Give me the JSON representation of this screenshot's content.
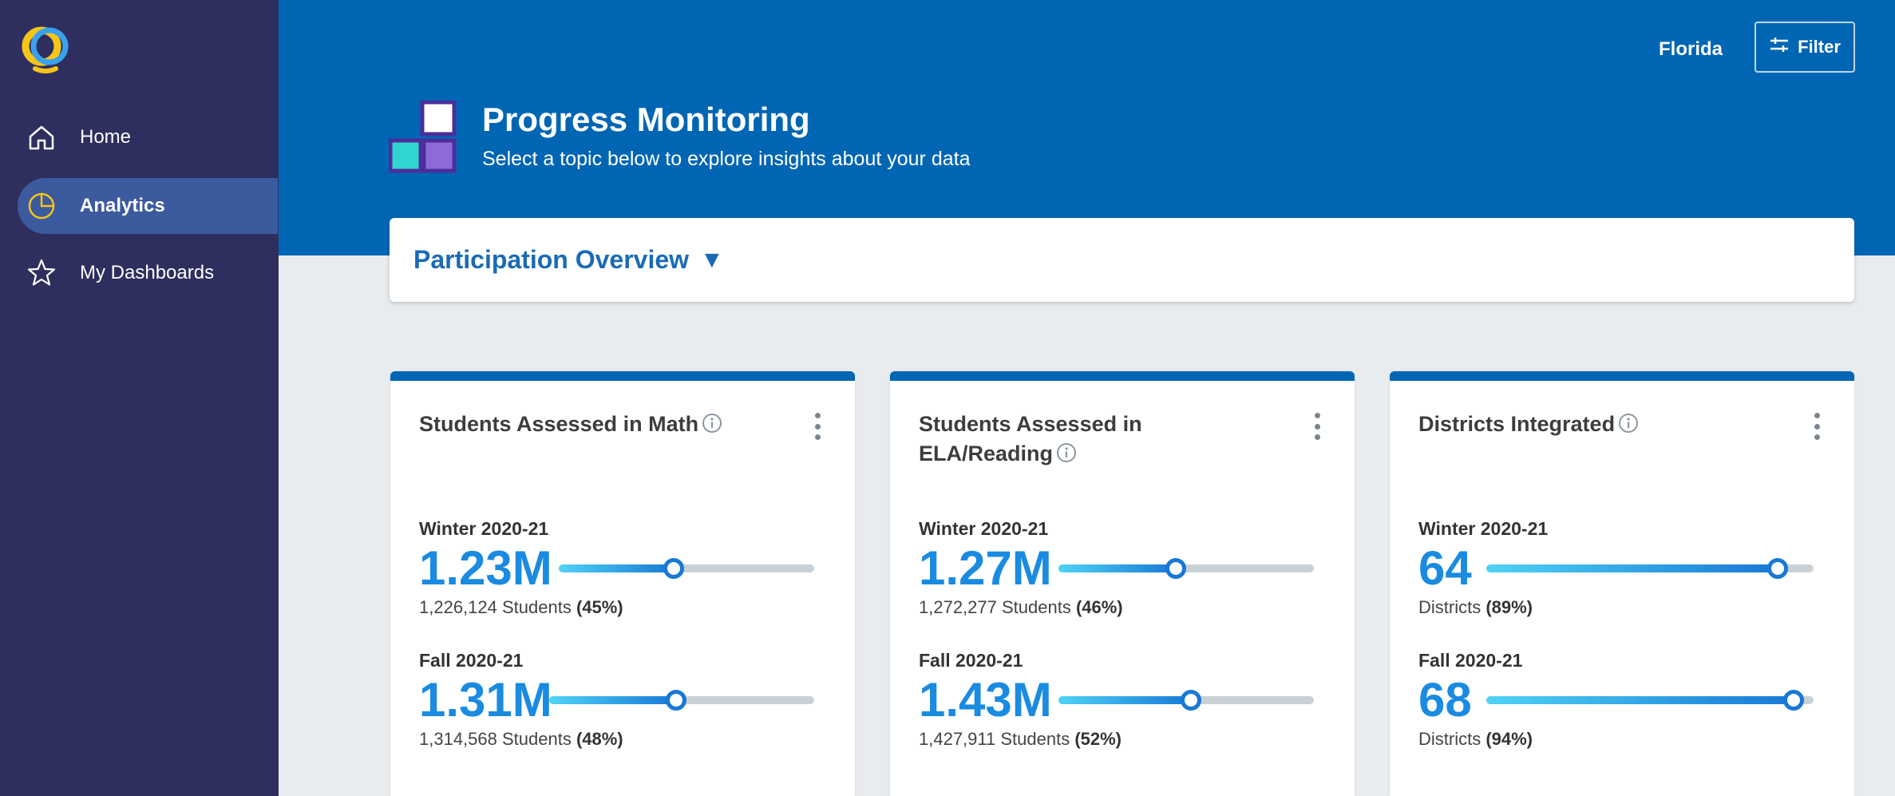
{
  "sidebar": {
    "items": [
      {
        "label": "Home",
        "icon": "home-icon",
        "active": false
      },
      {
        "label": "Analytics",
        "icon": "pie-chart-icon",
        "active": true
      },
      {
        "label": "My Dashboards",
        "icon": "star-icon",
        "active": false
      }
    ]
  },
  "header": {
    "region": "Florida",
    "filter_label": "Filter",
    "title": "Progress Monitoring",
    "subtitle": "Select a topic below to explore insights about your data"
  },
  "topic": {
    "label": "Participation Overview",
    "arrow": "▼"
  },
  "colors": {
    "sidebar": "#2e2f5e",
    "header": "#0066b3",
    "accent": "#1a8be0"
  },
  "cards": [
    {
      "title": "Students Assessed in Math",
      "periods": [
        {
          "label": "Winter 2020-21",
          "value": "1.23M",
          "detail_prefix": "1,226,124 Students ",
          "detail_pct": "(45%)",
          "fill": 0.45
        },
        {
          "label": "Fall 2020-21",
          "value": "1.31M",
          "detail_prefix": "1,314,568 Students ",
          "detail_pct": "(48%)",
          "fill": 0.48
        }
      ]
    },
    {
      "title": "Students Assessed in ELA/Reading",
      "periods": [
        {
          "label": "Winter 2020-21",
          "value": "1.27M",
          "detail_prefix": "1,272,277 Students ",
          "detail_pct": "(46%)",
          "fill": 0.46
        },
        {
          "label": "Fall 2020-21",
          "value": "1.43M",
          "detail_prefix": "1,427,911 Students ",
          "detail_pct": "(52%)",
          "fill": 0.52
        }
      ]
    },
    {
      "title": "Districts Integrated",
      "periods": [
        {
          "label": "Winter 2020-21",
          "value": "64",
          "detail_prefix": "Districts ",
          "detail_pct": "(89%)",
          "fill": 0.89
        },
        {
          "label": "Fall 2020-21",
          "value": "68",
          "detail_prefix": "Districts ",
          "detail_pct": "(94%)",
          "fill": 0.94
        }
      ]
    }
  ]
}
